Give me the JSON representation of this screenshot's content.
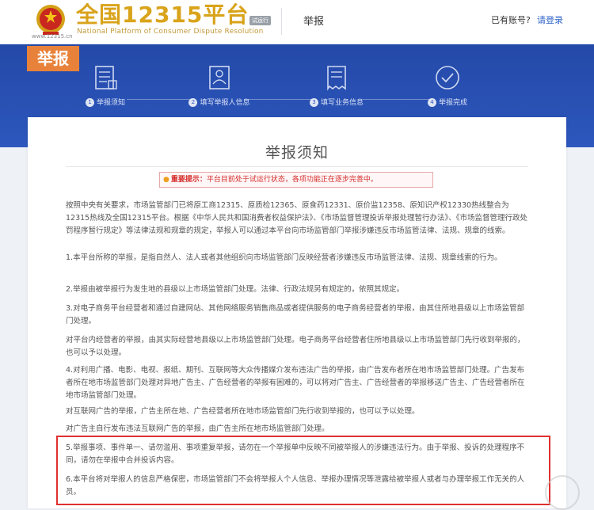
{
  "header": {
    "emblem_url": "www.12315.cn",
    "title": "全国12315平台",
    "subtitle": "National Platform of Consumer Dispute Resolution",
    "badge": "试运行",
    "section": "举报",
    "account_prompt": "已有账号?",
    "login": "请登录"
  },
  "banner": {
    "tag": "举报",
    "steps": [
      {
        "num": "1",
        "label": "举报须知",
        "icon": "document-list-icon"
      },
      {
        "num": "2",
        "label": "填写举报人信息",
        "icon": "person-form-icon"
      },
      {
        "num": "3",
        "label": "填写业务信息",
        "icon": "receipt-icon"
      },
      {
        "num": "4",
        "label": "举报完成",
        "icon": "check-circle-icon"
      }
    ]
  },
  "notice": {
    "title": "举报须知",
    "alert_label": "重要提示：",
    "alert_text": "平台目前处于试运行状态，各项功能正在逐步完善中。",
    "paragraphs": [
      "按照中央有关要求，市场监管部门已将原工商12315、原质检12365、原食药12331、原价监12358、原知识产权12330热线整合为12315热线及全国12315平台。根据《中华人民共和国消费者权益保护法》、《市场监督管理投诉举报处理暂行办法》、《市场监督管理行政处罚程序暂行规定》等法律法规和规章的规定，举报人可以通过本平台向市场监管部门举报涉嫌违反市场监管法律、法规、规章的线索。",
      "1.本平台所称的举报，是指自然人、法人或者其他组织向市场监管部门反映经营者涉嫌违反市场监管法律、法规、规章线索的行为。",
      "2.举报由被举报行为发生地的县级以上市场监管部门处理。法律、行政法规另有规定的，依照其规定。",
      "3.对电子商务平台经营者和通过自建网站、其他网络服务销售商品或者提供服务的电子商务经营者的举报，由其住所地县级以上市场监管部门处理。",
      "对平台内经营者的举报，由其实际经营地县级以上市场监管部门处理。电子商务平台经营者住所地县级以上市场监管部门先行收到举报的，也可以予以处理。",
      "4.对利用广播、电影、电视、报纸、期刊、互联网等大众传播媒介发布违法广告的举报，由广告发布者所在地市场监管部门处理。广告发布者所在地市场监管部门处理对异地广告主、广告经营者的举报有困难的，可以将对广告主、广告经营者的举报移送广告主、广告经营者所在地市场监管部门处理。",
      "对互联网广告的举报，广告主所在地、广告经营者所在地市场监管部门先行收到举报的，也可以予以处理。",
      "对广告主自行发布违法互联网广告的举报，由广告主所在地市场监管部门处理。",
      "5.举报事项、事件单一、请勿滥用、事项重复举报，请勿在一个举报单中反映不同被举报人的涉嫌违法行为。由于举报、投诉的处理程序不同，请勿在举报中合并投诉内容。",
      "6.本平台将对举报人的信息严格保密，市场监管部门不会将举报人个人信息、举报办理情况等泄露给被举报人或者与办理举报工作无关的人员。"
    ]
  }
}
